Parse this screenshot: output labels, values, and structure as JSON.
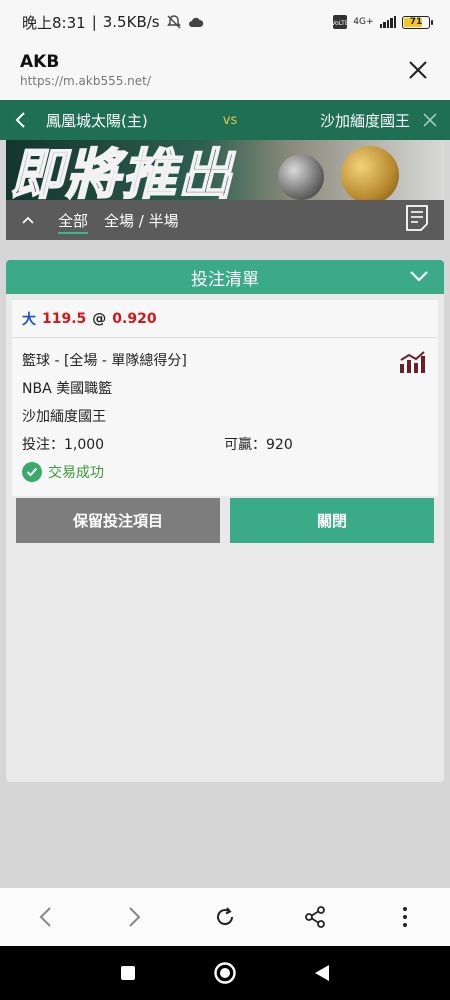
{
  "status_bar": {
    "time": "晚上8:31",
    "net_speed": "3.5KB/s",
    "network": "4G+",
    "battery": "71"
  },
  "browser": {
    "site_title": "AKB",
    "url": "https://m.akb555.net/"
  },
  "match": {
    "home_team": "鳳凰城太陽(主)",
    "vs": "vs",
    "away_team": "沙加緬度國王"
  },
  "banner": {
    "text": "即將推出"
  },
  "filter": {
    "tabs": [
      "全部",
      "全場 / 半場"
    ],
    "active_tab": 0
  },
  "slip": {
    "title": "投注清單",
    "selection": {
      "direction": "大",
      "line": "119.5",
      "at": "@",
      "odds": "0.920"
    },
    "sport_market": "籃球 - [全場 - 單隊總得分]",
    "league": "NBA 美國職籃",
    "team": "沙加緬度國王",
    "stake_label": "投注：1,000",
    "win_label": "可贏：920",
    "status": "交易成功",
    "keep_button": "保留投注項目",
    "close_button": "關閉"
  },
  "colors": {
    "accent_green": "#3aaa87",
    "header_green": "#1f6f54",
    "odds_red": "#d01818",
    "direction_blue": "#1a4fd0"
  }
}
